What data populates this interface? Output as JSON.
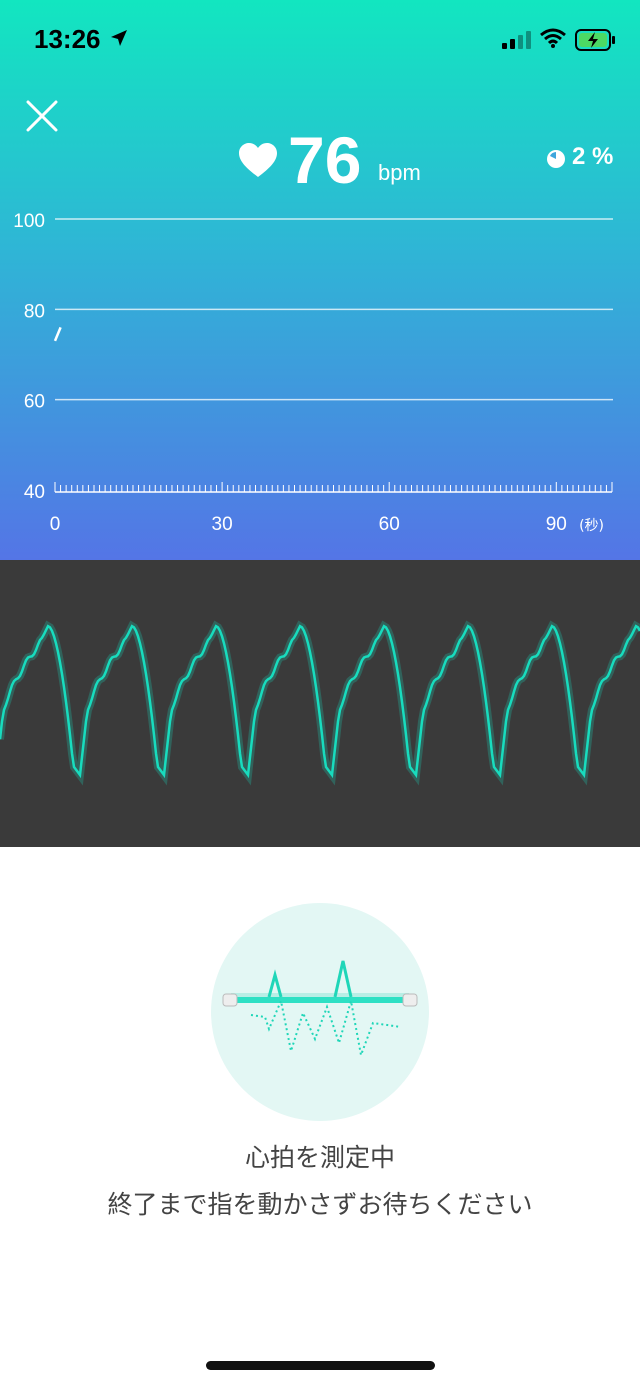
{
  "status_bar": {
    "time": "13:26",
    "icons": [
      "location-arrow-icon",
      "cellular-signal-icon",
      "wifi-icon",
      "battery-charging-icon"
    ]
  },
  "header": {
    "close_icon": "close-icon",
    "heart_icon": "heart-icon",
    "bpm_value": "76",
    "bpm_unit": "bpm",
    "progress_percent": "2 %"
  },
  "chart_data": {
    "type": "line",
    "y_ticks": [
      "100",
      "80",
      "60",
      "40"
    ],
    "x_ticks": [
      "0",
      "30",
      "60",
      "90"
    ],
    "x_unit": "(秒)",
    "ylim": [
      40,
      100
    ],
    "xlim": [
      0,
      100
    ],
    "grid": true,
    "series": [
      {
        "x": [
          0,
          1
        ],
        "y": [
          73,
          76
        ]
      }
    ]
  },
  "waveform": {
    "color": "#18dcbe",
    "description_icon": "pulse-waveform"
  },
  "measurement": {
    "illustration_icon": "heartbeat-sensor-icon",
    "title": "心拍を測定中",
    "instruction": "終了まで指を動かさずお待ちください"
  },
  "colors": {
    "gradient_top": "#12e6c0",
    "gradient_bottom": "#5475e6",
    "accent": "#18dcbe",
    "wave_bg": "#3a3a3a"
  }
}
